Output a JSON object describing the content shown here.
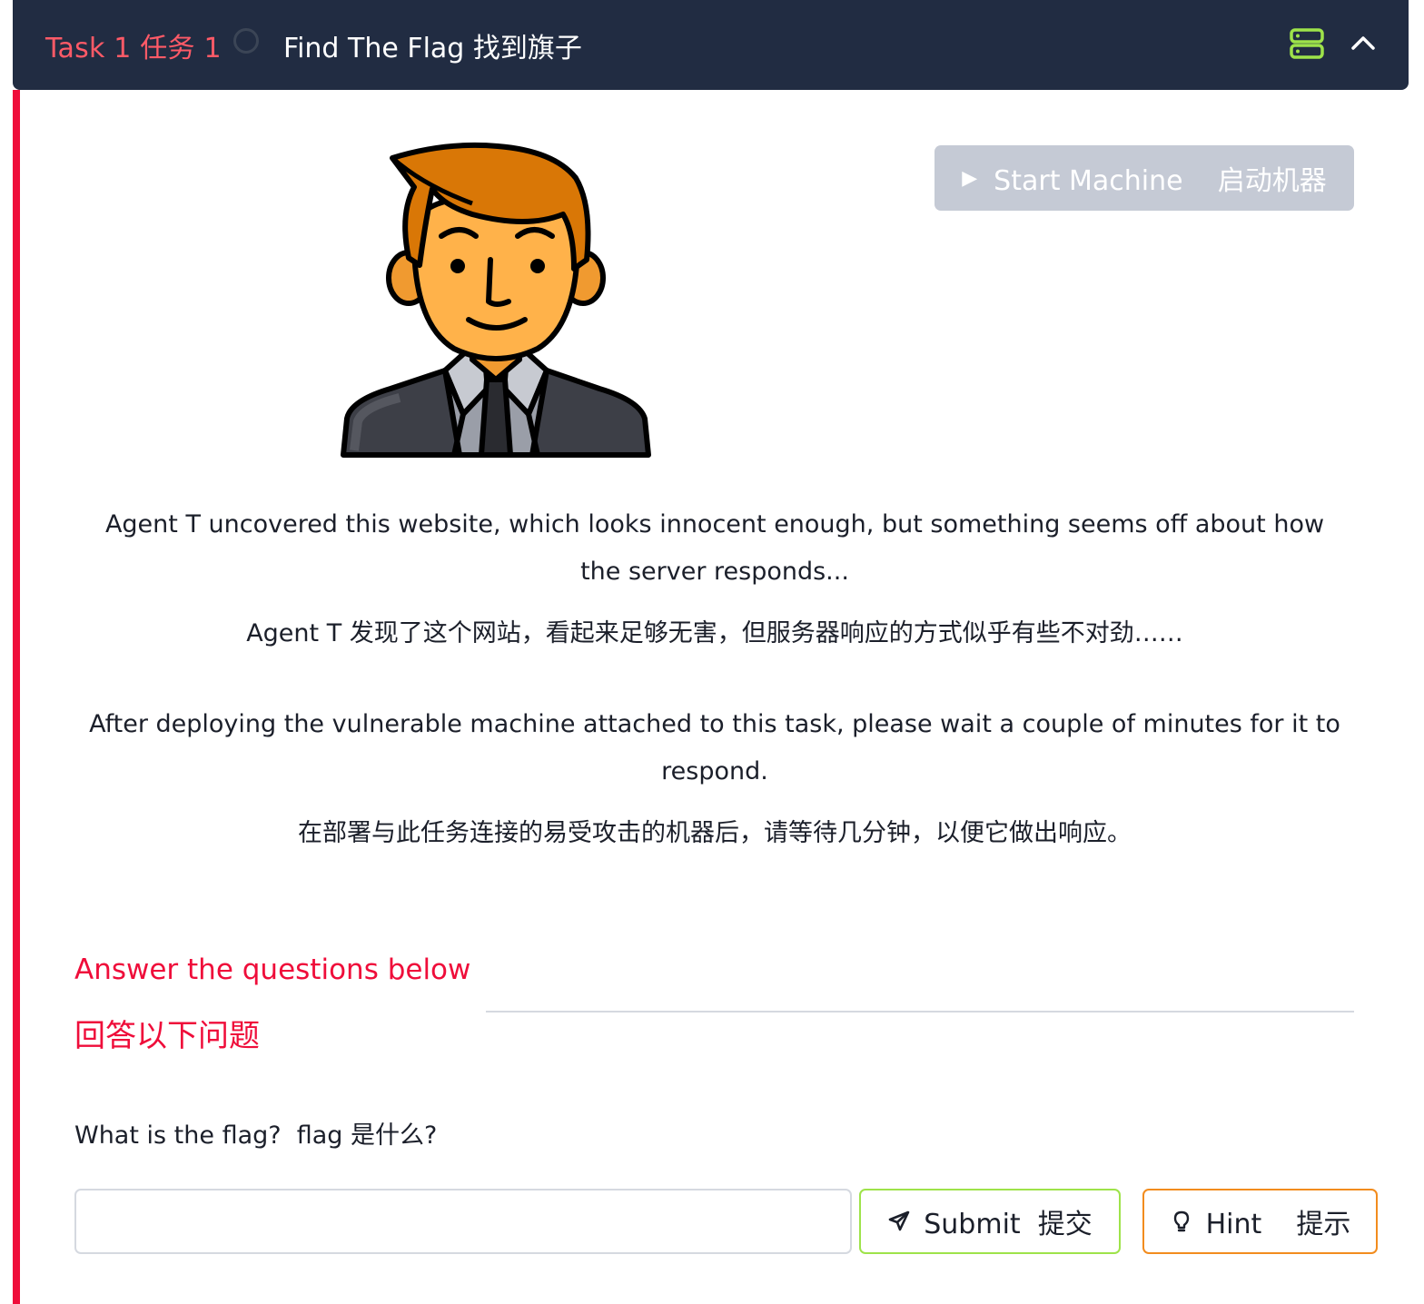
{
  "header": {
    "task_label": "Task 1  任务 1",
    "title": "Find The Flag  找到旗子",
    "colors": {
      "background": "#212c42",
      "task_label": "#ff5a67",
      "server_icon": "#9ee34a"
    },
    "icons": {
      "status": "circle-outline-icon",
      "server": "server-icon",
      "collapse": "chevron-up-icon"
    }
  },
  "machine": {
    "start_label": "Start Machine    启动机器",
    "start_icon": "play-icon"
  },
  "description": {
    "en_1": "Agent T uncovered this website, which looks innocent enough, but something seems off about how the server responds...",
    "zh_1": "Agent T 发现了这个网站，看起来足够无害，但服务器响应的方式似乎有些不对劲……",
    "en_2": "After deploying the vulnerable machine attached to this task, please wait a couple of minutes for it to respond.",
    "zh_2": "在部署与此任务连接的易受攻击的机器后，请等待几分钟，以便它做出响应。"
  },
  "questions": {
    "heading_en": "Answer the questions below",
    "heading_zh": "回答以下问题",
    "items": [
      {
        "text": "What is the flag?  flag 是什么?",
        "answer_value": "",
        "submit_label": "Submit  提交",
        "hint_label": "Hint    提示"
      }
    ]
  },
  "colors": {
    "accent": "#ef0d3a",
    "submit_border": "#9ee34a",
    "hint_border": "#f28c1e",
    "start_disabled_bg": "#c5cad5"
  }
}
